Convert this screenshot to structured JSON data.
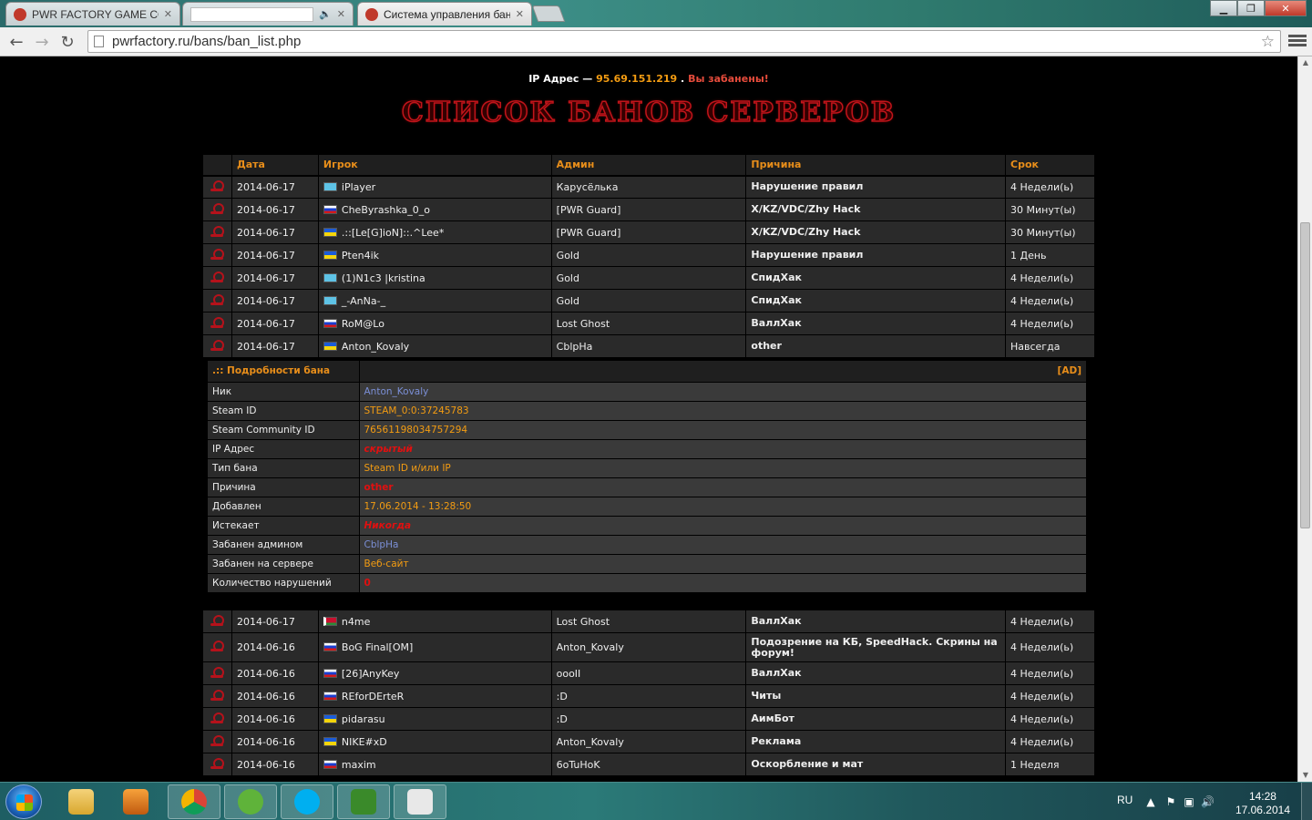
{
  "browser": {
    "tabs": [
      {
        "title": "PWR FACTORY GAME CO",
        "active": false
      },
      {
        "title": "",
        "active": false,
        "audio": true
      },
      {
        "title": "Система управления бан",
        "active": true
      }
    ],
    "url": "pwrfactory.ru/bans/ban_list.php"
  },
  "page": {
    "ip_label": "IP Адрес —",
    "ip_value": "95.69.151.219",
    "ip_sep": ".",
    "banned_text": "Вы забанены!",
    "title": "СПИСОК БАНОВ СЕРВЕРОВ"
  },
  "ban_table": {
    "headers": {
      "date": "Дата",
      "player": "Игрок",
      "admin": "Админ",
      "reason": "Причина",
      "term": "Срок"
    },
    "rows_top": [
      {
        "date": "2014-06-17",
        "flag": "kz",
        "player": "iPlayer",
        "admin": "Карусёлька",
        "reason": "Нарушение правил",
        "term": "4 Недели(ь)"
      },
      {
        "date": "2014-06-17",
        "flag": "ru",
        "player": "CheByrashka_0_o",
        "admin": "[PWR Guard]",
        "reason": "X/KZ/VDC/Zhy Hack",
        "term": "30 Минут(ы)"
      },
      {
        "date": "2014-06-17",
        "flag": "ua",
        "player": ".::[Le[G]ioN]::.^Lee*",
        "admin": "[PWR Guard]",
        "reason": "X/KZ/VDC/Zhy Hack",
        "term": "30 Минут(ы)"
      },
      {
        "date": "2014-06-17",
        "flag": "ua",
        "player": "Pten4ik",
        "admin": "Gold",
        "reason": "Нарушение правил",
        "term": "1 День"
      },
      {
        "date": "2014-06-17",
        "flag": "kz",
        "player": "(1)N1c3 |kristina",
        "admin": "Gold",
        "reason": "СпидХак",
        "term": "4 Недели(ь)"
      },
      {
        "date": "2014-06-17",
        "flag": "kz",
        "player": "_-AnNa-_",
        "admin": "Gold",
        "reason": "СпидХак",
        "term": "4 Недели(ь)"
      },
      {
        "date": "2014-06-17",
        "flag": "ru",
        "player": "RoM@Lo",
        "admin": "Lost Ghost",
        "reason": "ВаллХак",
        "term": "4 Недели(ь)"
      },
      {
        "date": "2014-06-17",
        "flag": "ua",
        "player": "Anton_Kovaly",
        "admin": "CblpHa",
        "reason": "other",
        "term": "Навсегда"
      }
    ],
    "rows_bottom": [
      {
        "date": "2014-06-17",
        "flag": "by",
        "player": "n4me",
        "admin": "Lost Ghost",
        "reason": "ВаллХак",
        "term": "4 Недели(ь)",
        "tall": false
      },
      {
        "date": "2014-06-16",
        "flag": "ru",
        "player": "BoG Final[OM]",
        "admin": "Anton_Kovaly",
        "reason": "Подозрение на КБ, SpeedHack. Скрины на форум!",
        "term": "4 Недели(ь)",
        "tall": true
      },
      {
        "date": "2014-06-16",
        "flag": "ru",
        "player": "[26]AnyKey",
        "admin": "oooII",
        "reason": "ВаллХак",
        "term": "4 Недели(ь)",
        "tall": false
      },
      {
        "date": "2014-06-16",
        "flag": "ru",
        "player": "REforDErteR",
        "admin": ":D",
        "reason": "Читы",
        "term": "4 Недели(ь)",
        "tall": false
      },
      {
        "date": "2014-06-16",
        "flag": "ua",
        "player": "pidarasu",
        "admin": ":D",
        "reason": "АимБот",
        "term": "4 Недели(ь)",
        "tall": false
      },
      {
        "date": "2014-06-16",
        "flag": "ua",
        "player": "NIKE#xD",
        "admin": "Anton_Kovaly",
        "reason": "Реклама",
        "term": "4 Недели(ь)",
        "tall": false
      },
      {
        "date": "2014-06-16",
        "flag": "ru",
        "player": "maxim",
        "admin": "6oTuHoK",
        "reason": "Оскорбление и мат",
        "term": "1 Неделя",
        "tall": false
      }
    ]
  },
  "details": {
    "header": ".:: Подробности бана",
    "ad_link": "[AD]",
    "rows": [
      {
        "label": "Ник",
        "value": "Anton_Kovaly",
        "style": "blue"
      },
      {
        "label": "Steam ID",
        "value": "STEAM_0:0:37245783",
        "style": "orange"
      },
      {
        "label": "Steam Community ID",
        "value": "76561198034757294",
        "style": "orange"
      },
      {
        "label": "IP Адрес",
        "value": "скрытый",
        "style": "red-italic"
      },
      {
        "label": "Тип бана",
        "value": "Steam ID и/или IP",
        "style": "orange"
      },
      {
        "label": "Причина",
        "value": "other",
        "style": "red"
      },
      {
        "label": "Добавлен",
        "value": "17.06.2014 - 13:28:50",
        "style": "orange"
      },
      {
        "label": "Истекает",
        "value": "Никогда",
        "style": "red-italic"
      },
      {
        "label": "Забанен админом",
        "value": "CblpHa",
        "style": "blue"
      },
      {
        "label": "Забанен на сервере",
        "value": "Веб-сайт",
        "style": "orange"
      },
      {
        "label": "Количество нарушений",
        "value": "0",
        "style": "red"
      }
    ]
  },
  "taskbar": {
    "apps": [
      "explorer-icon",
      "media-player-icon",
      "chrome-icon",
      "utorrent-icon",
      "skype-icon",
      "qip-icon",
      "counter-strike-icon"
    ],
    "lang": "RU",
    "time": "14:28",
    "date": "17.06.2014"
  }
}
